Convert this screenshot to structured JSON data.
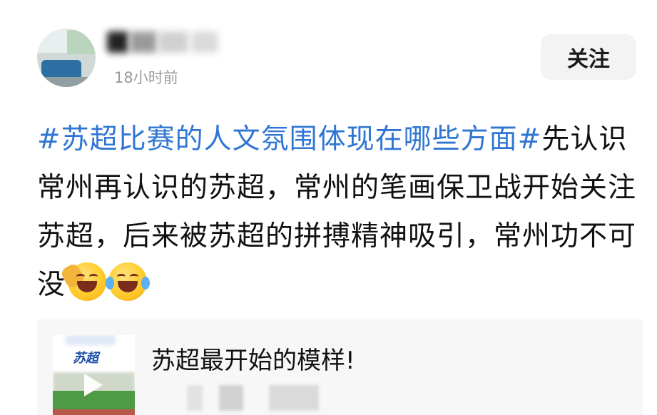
{
  "post": {
    "time": "18小时前",
    "follow_label": "关注",
    "topic": "#苏超比赛的人文氛围体现在哪些方面#",
    "body": "先认识常州再认识的苏超，常州的笔画保卫战开始关注苏超，后来被苏超的拼搏精神吸引，常州功不可没",
    "emojis": [
      "facepalm-laugh-emoji",
      "laugh-cry-emoji"
    ]
  },
  "card": {
    "title": "苏超最开始的模样!",
    "thumbnail_logo": "苏超"
  },
  "colors": {
    "topic": "#2f76d2",
    "text": "#111111",
    "follow_bg": "#f3f3f3",
    "card_bg": "#f7f7f7"
  }
}
